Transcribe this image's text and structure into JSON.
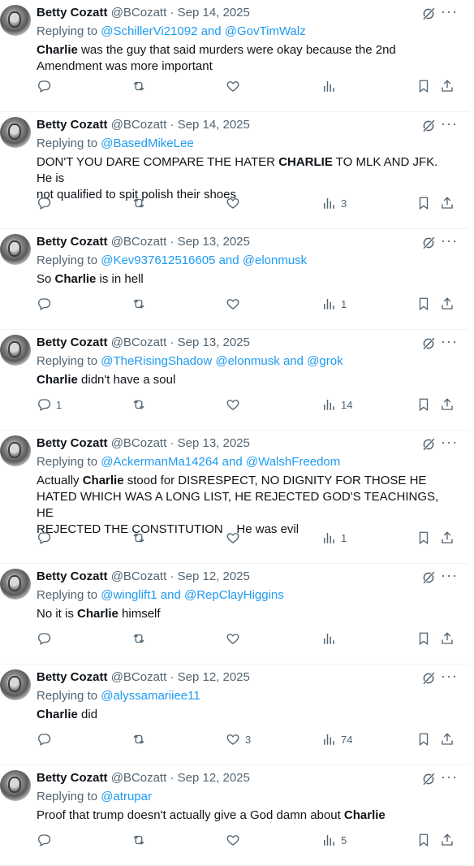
{
  "author": {
    "name": "Betty Cozatt",
    "handle": "@BCozatt"
  },
  "reply_prefix": "Replying to ",
  "dot": "·",
  "tweets": [
    {
      "date": "Sep 14, 2025",
      "replying_to": "@SchillerVi21092 and @GovTimWalz",
      "text_parts": [
        {
          "t": "Charlie",
          "b": true
        },
        {
          "t": " was the guy that said murders were okay because the 2nd\nAmendment was more important",
          "b": false
        }
      ],
      "replies": "",
      "likes": "",
      "views": ""
    },
    {
      "date": "Sep 14, 2025",
      "replying_to": "@BasedMikeLee",
      "text_parts": [
        {
          "t": "DON'T YOU DARE COMPARE THE HATER ",
          "b": false
        },
        {
          "t": "CHARLIE",
          "b": true
        },
        {
          "t": " TO MLK AND JFK.  He is\nnot qualified to spit polish their shoes",
          "b": false
        }
      ],
      "replies": "",
      "likes": "",
      "views": "3"
    },
    {
      "date": "Sep 13, 2025",
      "replying_to": "@Kev937612516605 and @elonmusk",
      "text_parts": [
        {
          "t": "So ",
          "b": false
        },
        {
          "t": "Charlie",
          "b": true
        },
        {
          "t": " is in hell",
          "b": false
        }
      ],
      "replies": "",
      "likes": "",
      "views": "1"
    },
    {
      "date": "Sep 13, 2025",
      "replying_to": "@TheRisingShadow @elonmusk and @grok",
      "text_parts": [
        {
          "t": "Charlie",
          "b": true
        },
        {
          "t": " didn't have a soul",
          "b": false
        }
      ],
      "replies": "1",
      "likes": "",
      "views": "14"
    },
    {
      "date": "Sep 13, 2025",
      "replying_to": "@AckermanMa14264 and @WalshFreedom",
      "text_parts": [
        {
          "t": "Actually ",
          "b": false
        },
        {
          "t": "Charlie",
          "b": true
        },
        {
          "t": " stood for DISRESPECT, NO DIGNITY FOR THOSE HE\nHATED WHICH WAS A LONG LIST, HE REJECTED GOD'S TEACHINGS, HE\nREJECTED THE CONSTITUTION    He was evil",
          "b": false
        }
      ],
      "replies": "",
      "likes": "",
      "views": "1"
    },
    {
      "date": "Sep 12, 2025",
      "replying_to": "@winglift1 and @RepClayHiggins",
      "text_parts": [
        {
          "t": "No it is ",
          "b": false
        },
        {
          "t": "Charlie",
          "b": true
        },
        {
          "t": " himself",
          "b": false
        }
      ],
      "replies": "",
      "likes": "",
      "views": ""
    },
    {
      "date": "Sep 12, 2025",
      "replying_to": "@alyssamariiee11",
      "text_parts": [
        {
          "t": "Charlie",
          "b": true
        },
        {
          "t": " did",
          "b": false
        }
      ],
      "replies": "",
      "likes": "3",
      "views": "74"
    },
    {
      "date": "Sep 12, 2025",
      "replying_to": "@atrupar",
      "text_parts": [
        {
          "t": "Proof that trump doesn't actually give a God damn about ",
          "b": false
        },
        {
          "t": "Charlie",
          "b": true
        }
      ],
      "replies": "",
      "likes": "",
      "views": "5"
    }
  ],
  "icons": {
    "reply": "reply-icon",
    "retweet": "retweet-icon",
    "like": "heart-icon",
    "views": "views-icon",
    "bookmark": "bookmark-icon",
    "share": "share-icon",
    "grok": "grok-icon",
    "more": "more-icon"
  },
  "colors": {
    "link": "#1d9bf0",
    "muted": "#536471",
    "text": "#0f1419",
    "divider": "#eff3f4"
  }
}
